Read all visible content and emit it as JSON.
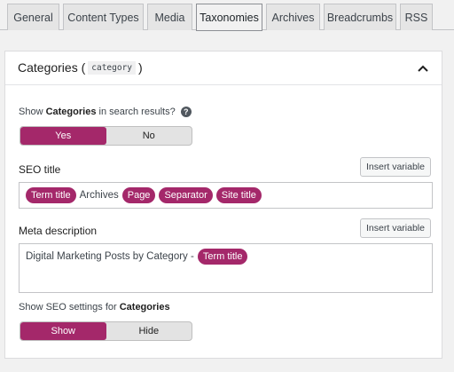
{
  "tabs": [
    {
      "label": "General",
      "active": false
    },
    {
      "label": "Content Types",
      "active": false
    },
    {
      "label": "Media",
      "active": false
    },
    {
      "label": "Taxonomies",
      "active": true
    },
    {
      "label": "Archives",
      "active": false
    },
    {
      "label": "Breadcrumbs",
      "active": false
    },
    {
      "label": "RSS",
      "active": false
    }
  ],
  "panel": {
    "title": "Categories (",
    "slug": "category",
    "title_close": ")",
    "collapse_icon": "chevron-up-icon"
  },
  "search_results": {
    "label_pre": "Show ",
    "label_bold": "Categories",
    "label_post": " in search results?",
    "help_icon": "?",
    "yes": "Yes",
    "no": "No",
    "selected": "Yes"
  },
  "seo_title": {
    "label": "SEO title",
    "insert_variable": "Insert variable",
    "tokens": [
      {
        "type": "pill",
        "text": "Term title"
      },
      {
        "type": "text",
        "text": "Archives"
      },
      {
        "type": "pill",
        "text": "Page"
      },
      {
        "type": "pill",
        "text": "Separator"
      },
      {
        "type": "pill",
        "text": "Site title"
      }
    ]
  },
  "meta_description": {
    "label": "Meta description",
    "insert_variable": "Insert variable",
    "text": "Digital Marketing Posts by Category -",
    "pill": "Term title"
  },
  "seo_settings": {
    "label_pre": "Show SEO settings for ",
    "label_bold": "Categories",
    "show": "Show",
    "hide": "Hide",
    "selected": "Show"
  },
  "colors": {
    "accent": "#a4286a",
    "toggle_off_bg": "#e3e3e3",
    "page_bg": "#f1f1f1"
  }
}
